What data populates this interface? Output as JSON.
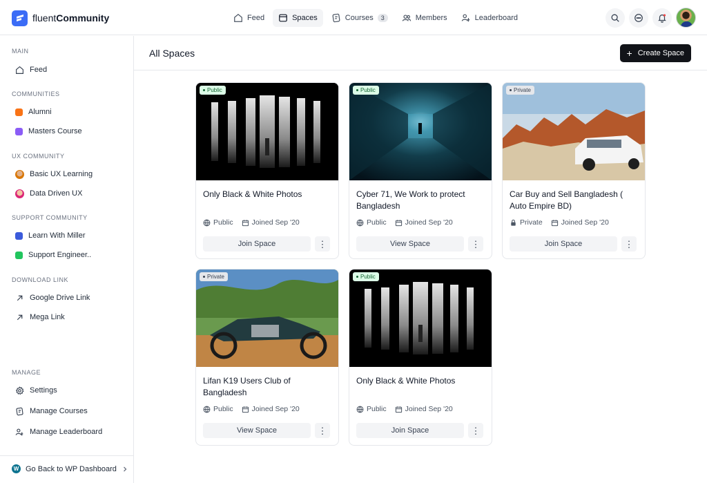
{
  "brand": {
    "name_light": "fluent",
    "name_bold": "Community"
  },
  "nav": [
    {
      "label": "Feed",
      "icon": "home-icon",
      "active": false
    },
    {
      "label": "Spaces",
      "icon": "spaces-icon",
      "active": true
    },
    {
      "label": "Courses",
      "icon": "courses-icon",
      "badge": "3",
      "active": false
    },
    {
      "label": "Members",
      "icon": "members-icon",
      "active": false
    },
    {
      "label": "Leaderboard",
      "icon": "leaderboard-icon",
      "active": false
    }
  ],
  "sidebar": {
    "main_title": "MAIN",
    "feed_label": "Feed",
    "communities_title": "COMMUNITIES",
    "communities": [
      {
        "label": "Alumni",
        "color": "#f97316"
      },
      {
        "label": "Masters Course",
        "color": "#8b5cf6"
      }
    ],
    "ux_title": "UX COMMUNITY",
    "ux": [
      {
        "label": "Basic UX Learning"
      },
      {
        "label": "Data Driven UX"
      }
    ],
    "support_title": "SUPPORT COMMUNITY",
    "support": [
      {
        "label": "Learn With Miller",
        "color": "#3b5bdb"
      },
      {
        "label": "Support Engineer..",
        "color": "#22c55e"
      }
    ],
    "download_title": "DOWNLOAD LINK",
    "download": [
      {
        "label": "Google Drive Link"
      },
      {
        "label": "Mega Link"
      }
    ],
    "manage_title": "MANAGE",
    "manage": [
      {
        "label": "Settings",
        "icon": "gear-icon"
      },
      {
        "label": "Manage Courses",
        "icon": "courses-icon"
      },
      {
        "label": "Manage Leaderboard",
        "icon": "leaderboard-icon"
      }
    ],
    "back_label": "Go Back to WP Dashboard"
  },
  "main": {
    "title": "All Spaces",
    "create_label": "Create Space"
  },
  "cards": [
    {
      "privacy": "Public",
      "title": "Only Black & White Photos",
      "access": "Public",
      "joined": "Joined Sep '20",
      "action": "Join Space",
      "image": "bw"
    },
    {
      "privacy": "Public",
      "title": "Cyber 71, We Work to protect Bangladesh",
      "access": "Public",
      "joined": "Joined Sep '20",
      "action": "View Space",
      "image": "tunnel"
    },
    {
      "privacy": "Private",
      "title": "Car Buy and Sell Bangladesh ( Auto Empire BD)",
      "access": "Private",
      "joined": "Joined Sep '20",
      "action": "Join Space",
      "image": "car"
    },
    {
      "privacy": "Private",
      "title": "Lifan K19 Users Club of Bangladesh",
      "access": "Public",
      "joined": "Joined Sep '20",
      "action": "View Space",
      "image": "bike"
    },
    {
      "privacy": "Public",
      "title": "Only Black & White Photos",
      "access": "Public",
      "joined": "Joined Sep '20",
      "action": "Join Space",
      "image": "bw"
    }
  ]
}
